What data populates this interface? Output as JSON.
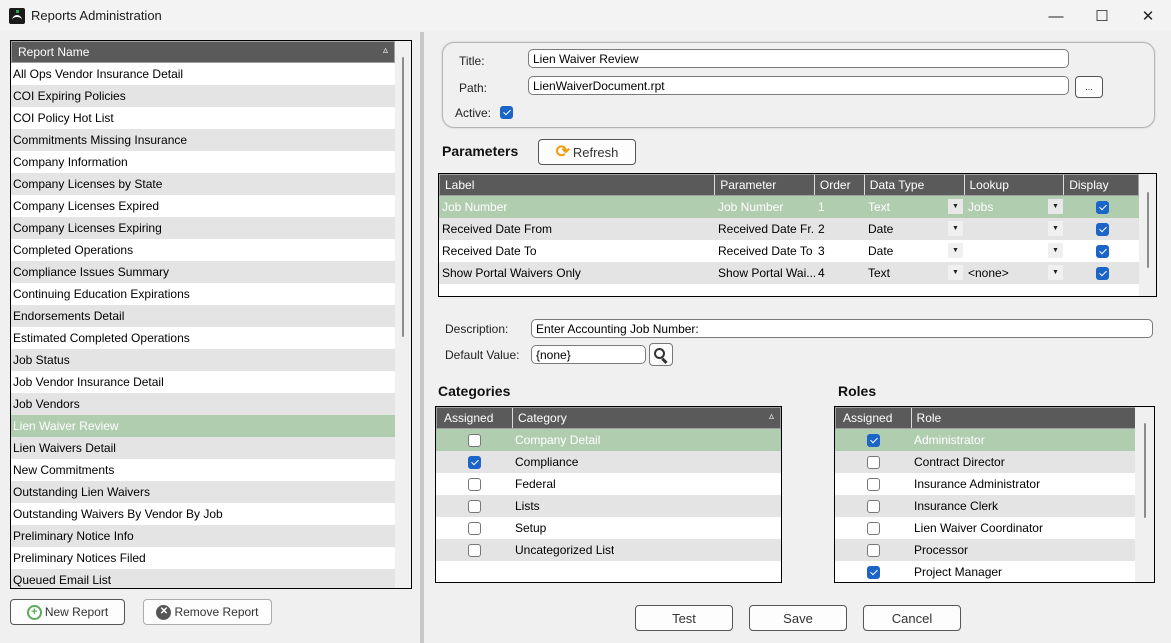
{
  "window": {
    "title": "Reports Administration",
    "controls": {
      "minimize": "—",
      "maximize": "☐",
      "close": "✕"
    }
  },
  "report_list": {
    "header": "Report Name",
    "sort_indicator": "▵",
    "items": [
      "All Ops Vendor Insurance Detail",
      "COI Expiring Policies",
      "COI Policy Hot List",
      "Commitments Missing Insurance",
      "Company Information",
      "Company Licenses by State",
      "Company Licenses Expired",
      "Company Licenses Expiring",
      "Completed Operations",
      "Compliance Issues Summary",
      "Continuing Education Expirations",
      "Endorsements Detail",
      "Estimated Completed Operations",
      "Job Status",
      "Job Vendor Insurance Detail",
      "Job Vendors",
      "Lien Waiver Review",
      "Lien Waivers Detail",
      "New Commitments",
      "Outstanding Lien Waivers",
      "Outstanding Waivers By Vendor By Job",
      "Preliminary Notice Info",
      "Preliminary Notices Filed",
      "Queued Email List"
    ],
    "selected_index": 16,
    "new_report_label": "New Report",
    "remove_report_label": "Remove Report"
  },
  "report_info": {
    "title_label": "Title:",
    "title_value": "Lien Waiver Review",
    "path_label": "Path:",
    "path_value": "LienWaiverDocument.rpt",
    "browse_label": "...",
    "active_label": "Active:",
    "active": true
  },
  "parameters": {
    "section_title": "Parameters",
    "refresh_label": "Refresh",
    "columns": [
      "Label",
      "Parameter",
      "Order",
      "Data Type",
      "Lookup",
      "Display"
    ],
    "rows": [
      {
        "label": "Job Number",
        "parameter": "Job Number",
        "order": "1",
        "data_type": "Text",
        "lookup": "Jobs",
        "display": true
      },
      {
        "label": "Received Date From",
        "parameter": "Received Date Fr...",
        "order": "2",
        "data_type": "Date",
        "lookup": "",
        "display": true
      },
      {
        "label": "Received Date To",
        "parameter": "Received Date To",
        "order": "3",
        "data_type": "Date",
        "lookup": "",
        "display": true
      },
      {
        "label": "Show Portal Waivers Only",
        "parameter": "Show Portal Wai...",
        "order": "4",
        "data_type": "Text",
        "lookup": "<none>",
        "display": true
      }
    ],
    "selected_index": 0,
    "description_label": "Description:",
    "description_value": "Enter Accounting Job Number:",
    "default_value_label": "Default Value:",
    "default_value": "{none}"
  },
  "categories": {
    "section_title": "Categories",
    "columns": [
      "Assigned",
      "Category"
    ],
    "sort_indicator": "▵",
    "rows": [
      {
        "assigned": false,
        "name": "Company Detail"
      },
      {
        "assigned": true,
        "name": "Compliance"
      },
      {
        "assigned": false,
        "name": "Federal"
      },
      {
        "assigned": false,
        "name": "Lists"
      },
      {
        "assigned": false,
        "name": "Setup"
      },
      {
        "assigned": false,
        "name": "Uncategorized List"
      }
    ],
    "selected_index": 0
  },
  "roles": {
    "section_title": "Roles",
    "columns": [
      "Assigned",
      "Role"
    ],
    "rows": [
      {
        "assigned": true,
        "name": "Administrator"
      },
      {
        "assigned": false,
        "name": "Contract Director"
      },
      {
        "assigned": false,
        "name": "Insurance Administrator"
      },
      {
        "assigned": false,
        "name": "Insurance Clerk"
      },
      {
        "assigned": false,
        "name": "Lien Waiver Coordinator"
      },
      {
        "assigned": false,
        "name": "Processor"
      },
      {
        "assigned": true,
        "name": "Project Manager"
      }
    ],
    "selected_index": 0
  },
  "actions": {
    "test_label": "Test",
    "save_label": "Save",
    "cancel_label": "Cancel"
  },
  "colors": {
    "header_bg": "#5a5a5a",
    "selected_row": "#b1cdb0",
    "alt_row": "#e4e4e4",
    "checkbox_on": "#1b64c8",
    "refresh_icon": "#f39c12",
    "add_icon": "#5aab5a"
  }
}
